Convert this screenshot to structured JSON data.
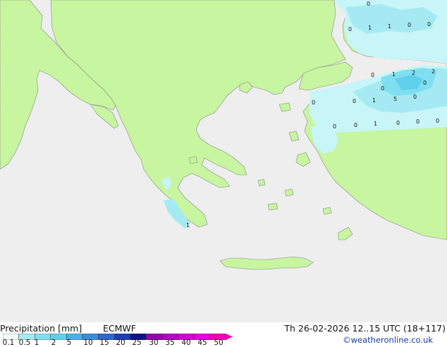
{
  "footer": {
    "title": "Precipitation [mm]",
    "model": "ECMWF",
    "valid_time": "Th 26-02-2026 12..15 UTC (18+117)",
    "credit": "©weatheronline.co.uk"
  },
  "legend": {
    "tick_labels": [
      "0.1",
      "0.5",
      "1",
      "2",
      "5",
      "10",
      "15",
      "20",
      "25",
      "30",
      "35",
      "40",
      "45",
      "50"
    ],
    "colors": [
      "#f3fefd",
      "#c8f5f7",
      "#a5eaf3",
      "#7fdff0",
      "#5fd0ec",
      "#4ab0e6",
      "#3a8cdc",
      "#2f67cf",
      "#1f3cb9",
      "#11108f",
      "#9400b0",
      "#b600c8",
      "#d000d8",
      "#e600e8",
      "#f000b4"
    ]
  },
  "map": {
    "land_color": "#c7f5a0",
    "sea_color": "#eeeeee",
    "border_color": "#666666",
    "precip_labels": [
      {
        "text": "0"
      },
      {
        "text": "0"
      },
      {
        "text": "1"
      },
      {
        "text": "1"
      },
      {
        "text": "0"
      },
      {
        "text": "0"
      },
      {
        "text": "0"
      },
      {
        "text": "1"
      },
      {
        "text": "2"
      },
      {
        "text": "2"
      },
      {
        "text": "0"
      },
      {
        "text": "0"
      },
      {
        "text": "1"
      },
      {
        "text": "5"
      },
      {
        "text": "0"
      },
      {
        "text": "0"
      },
      {
        "text": "0"
      },
      {
        "text": "1"
      },
      {
        "text": "0"
      },
      {
        "text": "0"
      },
      {
        "text": "0"
      },
      {
        "text": "0"
      },
      {
        "text": "0"
      },
      {
        "text": "1"
      }
    ]
  }
}
